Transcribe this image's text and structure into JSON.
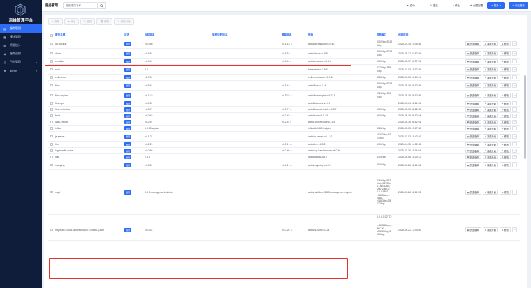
{
  "app": {
    "title": "运维管理平台"
  },
  "sidebar": {
    "items": [
      {
        "label": "服务管理",
        "icon": "server-icon",
        "active": true,
        "expandable": false
      },
      {
        "label": "模块管理",
        "icon": "grid-icon",
        "active": false,
        "expandable": false
      },
      {
        "label": "资源统计",
        "icon": "chart-icon",
        "active": false,
        "expandable": false
      },
      {
        "label": "服务巡检",
        "icon": "shield-icon",
        "active": false,
        "expandable": false
      },
      {
        "label": "日志管理",
        "icon": "document-icon",
        "active": false,
        "expandable": true
      },
      {
        "label": "admin",
        "icon": "user-icon",
        "active": false,
        "expandable": true
      }
    ]
  },
  "topbar": {
    "page_title": "服务管理",
    "search_placeholder": "搜索 服务名称",
    "buttons": {
      "start": "启动",
      "restart": "重启",
      "stop": "停止",
      "create_config": "创建配置",
      "more": "更多",
      "add_service": "添加服务"
    }
  },
  "toolbar": {
    "buttons": [
      "开始",
      "停止",
      "重启",
      "删除",
      "批量升级"
    ]
  },
  "table": {
    "headers": {
      "name": "服务名称",
      "status": "状态",
      "current_version": "当前版本",
      "arch_version": "架构适配版本",
      "latest_version": "最新版本",
      "image": "镜像",
      "ports": "容器端口",
      "created": "创建时间"
    },
    "row_actions": {
      "history": "历史版本",
      "upgrade": "离线升级",
      "edit": "修改",
      "more": "···"
    },
    "rows": [
      {
        "name": "db-backup",
        "status": "运行",
        "version": "v4.0.40",
        "arch": "",
        "latest": "v4.1.13",
        "latest_new": "↓",
        "image": "airiot/db-backup:v4.0.40",
        "ports": "9102/tcp,9012\n5/tcp",
        "created": "2025-04-15 14:45:48"
      },
      {
        "name": "driver",
        "status": "运行",
        "version": "v4.6.5",
        "arch": "",
        "latest": "v4.6.5",
        "latest_new": "↓",
        "image": "airiot/driver:v4.6.5",
        "ports": "9000/tcp,9224\n4/tcp",
        "created": "2025-05-17 07:57:26"
      },
      {
        "name": "emulator",
        "status": "运行",
        "version": "v4.4.4",
        "arch": "",
        "latest": "v4.4.4",
        "latest_new": "↓",
        "image": "airiot/emulator:v4.4.4",
        "ports": "9000/tcp",
        "created": "2025-05-17 07:57:26"
      },
      {
        "name": "etcd",
        "status": "运行",
        "version": "3.5",
        "arch": "",
        "latest": "",
        "latest_new": "",
        "image": "bitnami/etcd:3.5.5",
        "ports": "2379/tcp,238\n0/tcp",
        "created": "2025-03-03 15:17:35"
      },
      {
        "name": "exiledecor",
        "status": "运行",
        "version": "v0.7.6",
        "arch": "",
        "latest": "",
        "latest_new": "",
        "image": "exiledecor/exile:v0.7.6",
        "ports": "8080/tcp",
        "created": "2025-03-03 10:19:11"
      },
      {
        "name": "flow",
        "status": "运行",
        "version": "v4.5.4",
        "arch": "",
        "latest": "v4.5.4",
        "latest_new": "↓",
        "image": "airiot/flow:v4.5.4",
        "ports": "9000/tcp,9224\n4/tcp",
        "created": "2025-05-15 08:12:55"
      },
      {
        "name": "flow-engine",
        "status": "运行",
        "version": "v4.12.5",
        "arch": "",
        "latest": "v4.12.5",
        "latest_new": "↓",
        "image": "airiot/flow-engine:v4.12.5",
        "ports": "2323/tcp,900\n0/tcp",
        "created": "2025-05-15 08:12:55"
      },
      {
        "name": "flow-opc",
        "status": "运行",
        "version": "v4.0.8",
        "arch": "",
        "latest": "",
        "latest_new": "",
        "image": "airiot/flow-opc:v4.0.8",
        "ports": "",
        "created": "2025-03-04 11:16:45"
      },
      {
        "name": "flow-schedule",
        "status": "运行",
        "version": "v4.3.7",
        "arch": "",
        "latest": "v4.3.7",
        "latest_new": "↓",
        "image": "airiot/flow-schedule:v4.3.7",
        "ports": "9000/tcp",
        "created": "2025-05-15 08:12:55"
      },
      {
        "name": "front",
        "status": "运行",
        "version": "v4.0.43",
        "arch": "",
        "latest": "v4.0.43",
        "latest_new": "↓",
        "image": "airiot/front:v4.0.43",
        "ports": "9000/tcp",
        "created": "2025-05-15 08:12:54"
      },
      {
        "name": "l18n-encode",
        "status": "运行",
        "version": "v4.2.5",
        "arch": "",
        "latest": "v4.2.5",
        "latest_new": "↓",
        "image": "airiot/l18n-encode:v4.2.5",
        "ports": "",
        "created": "2025-05-15 08:12:51"
      },
      {
        "name": "influx",
        "status": "运行",
        "version": "1.8.10-alpine",
        "arch": "",
        "latest": "",
        "latest_new": "",
        "image": "influxdb:1.8.10-alpine",
        "ports": "8086/tcp",
        "created": "2025-03-03 15:17:35"
      },
      {
        "name": "js-server",
        "status": "运行",
        "version": "v4.1.21",
        "arch": "",
        "latest": "",
        "latest_new": "",
        "image": "airiot/js-server:v4.1.21",
        "ports": "19223/tcp,92\n23/tcp",
        "created": "2025-03-03 15:42:49"
      },
      {
        "name": "live",
        "status": "运行",
        "version": "v4.2.21",
        "arch": "",
        "latest": "v4.3.1",
        "latest_new": "↓↑",
        "image": "airiot/live:v4.2.21",
        "ports": "9000/tcp",
        "created": "2025-04-15 14:52:02"
      },
      {
        "name": "log-handle-node",
        "status": "运行",
        "version": "v4.0.46",
        "arch": "",
        "latest": "v4.0.46",
        "latest_new": "↓↑",
        "image": "airiot/log-handle-node:v4.0.46",
        "ports": "",
        "created": "2025-03-26 11:15:54"
      },
      {
        "name": "loki",
        "status": "运行",
        "version": "2.8.0",
        "arch": "",
        "latest": "",
        "latest_new": "",
        "image": "grafana/loki:2.8.0",
        "ports": "3100/tcp",
        "created": "2025-05-06 15:20:12"
      },
      {
        "name": "mapping",
        "status": "运行",
        "version": "v4.3.5",
        "arch": "",
        "latest": "v4.4.1",
        "latest_new": "↓↑",
        "image": "airiot/mapping:v4.3.5",
        "ports": "9000/tcp",
        "created": "2025-03-26 11:15:56"
      },
      {
        "name": "mqtt",
        "status": "运行",
        "version": "3.8.3-management-alpine",
        "arch": "",
        "latest": "",
        "latest_new": "",
        "image": "airiot/rabbitmq:3.8.3-management-alpine",
        "ports": "4369/tcp,567\n1/tcp,5672/tc\np,15671/tcp,\n15672/tcp,0.\n0.0.0:1883-\n>1883/tcp,:::\n1883-\n>1883/tcp,25\n672/tcp",
        "created": "2025-03-26 11:15:53"
      },
      {
        "name": "",
        "status": "",
        "version": "",
        "arch": "",
        "latest": "",
        "latest_new": "",
        "image": "",
        "ports": "0.0.0.0:32772",
        "created": ""
      },
      {
        "name": "mqyauto-67c567a6d2e5855d737d6df0-g340f",
        "status": "运行",
        "version": "v4.0.24",
        "arch": "",
        "latest": "v4.0.25",
        "latest_new": "↓↑",
        "image": "airiot/js340f:v4.0.24",
        "ports": "->58388/tcp,:::\n32772-\n>58388/tcp,8\n000/tcp",
        "created": "2025-05-21 17:04:02"
      }
    ]
  },
  "colors": {
    "accent": "#2d6cf4",
    "sidebar_bg": "#0f1d3a",
    "highlight": "#e5322d"
  }
}
